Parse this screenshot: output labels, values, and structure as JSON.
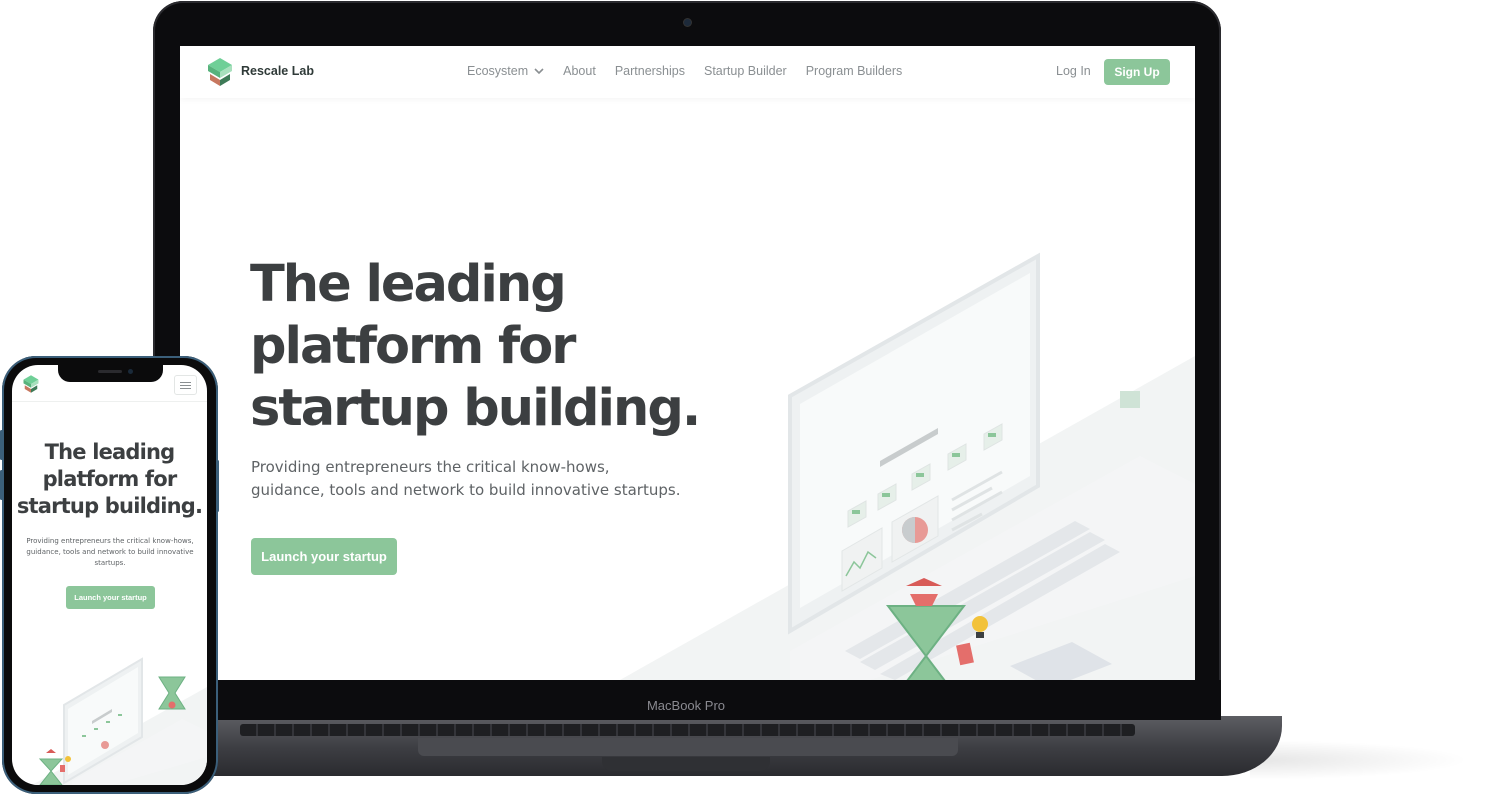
{
  "device_laptop": {
    "model_label": "MacBook Pro"
  },
  "site": {
    "brand": "Rescale Lab",
    "nav": {
      "items": [
        {
          "label": "Ecosystem",
          "has_dropdown": true
        },
        {
          "label": "About"
        },
        {
          "label": "Partnerships"
        },
        {
          "label": "Startup Builder"
        },
        {
          "label": "Program Builders"
        }
      ],
      "login_label": "Log In",
      "signup_label": "Sign Up"
    },
    "hero": {
      "title_lines": [
        "The leading",
        "platform for",
        "startup building."
      ],
      "subtitle": "Providing entrepreneurs the critical know-hows, guidance, tools and network to build innovative startups.",
      "cta_label": "Launch your startup"
    },
    "colors": {
      "accent": "#8cc69a",
      "text_dark": "#3c3f41",
      "text_muted": "#8a8f92"
    }
  },
  "phone": {
    "menu_icon": "hamburger-icon",
    "hero": {
      "title_lines": [
        "The leading",
        "platform for",
        "startup building."
      ],
      "subtitle": "Providing entrepreneurs the critical know-hows, guidance, tools and network to build innovative startups.",
      "cta_label": "Launch your startup"
    }
  }
}
